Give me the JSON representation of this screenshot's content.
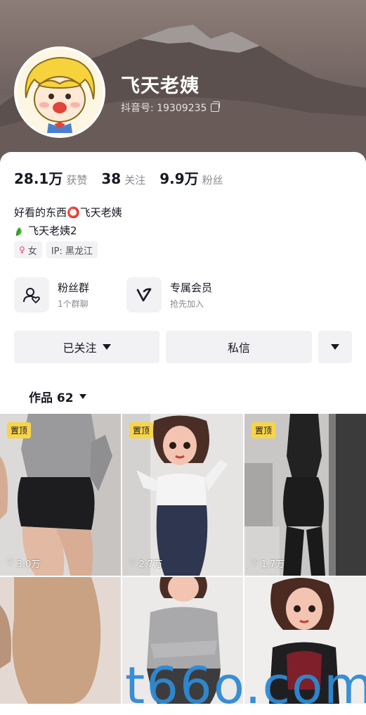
{
  "profile": {
    "nickname": "飞天老姨",
    "douyin_id": "抖音号: 19309235"
  },
  "stats": [
    {
      "num": "28.1万",
      "label": "获赞"
    },
    {
      "num": "38",
      "label": "关注"
    },
    {
      "num": "9.9万",
      "label": "粉丝"
    }
  ],
  "bio": {
    "line1": "好看的东西⭕飞天老姨",
    "line2": "飞天老姨2"
  },
  "tags": {
    "gender": "女",
    "ip": "IP: 黑龙江"
  },
  "features": {
    "fans_group": {
      "title": "粉丝群",
      "sub": "1个群聊"
    },
    "membership": {
      "title": "专属会员",
      "sub": "抢先加入"
    }
  },
  "buttons": {
    "following": "已关注",
    "message": "私信"
  },
  "works": {
    "label": "作品 62"
  },
  "videos": [
    {
      "pinned": "置顶",
      "likes": "3.0万"
    },
    {
      "pinned": "置顶",
      "likes": "2.7万"
    },
    {
      "pinned": "置顶",
      "likes": "1.7万"
    },
    {
      "pinned": "",
      "likes": ""
    },
    {
      "pinned": "",
      "likes": ""
    },
    {
      "pinned": "",
      "likes": ""
    }
  ],
  "watermark": "t66o.com",
  "colors": {
    "pin_badge": "#f8d449",
    "text_primary": "#161823",
    "text_secondary": "#8a8b91",
    "button_bg": "#f2f2f4"
  }
}
